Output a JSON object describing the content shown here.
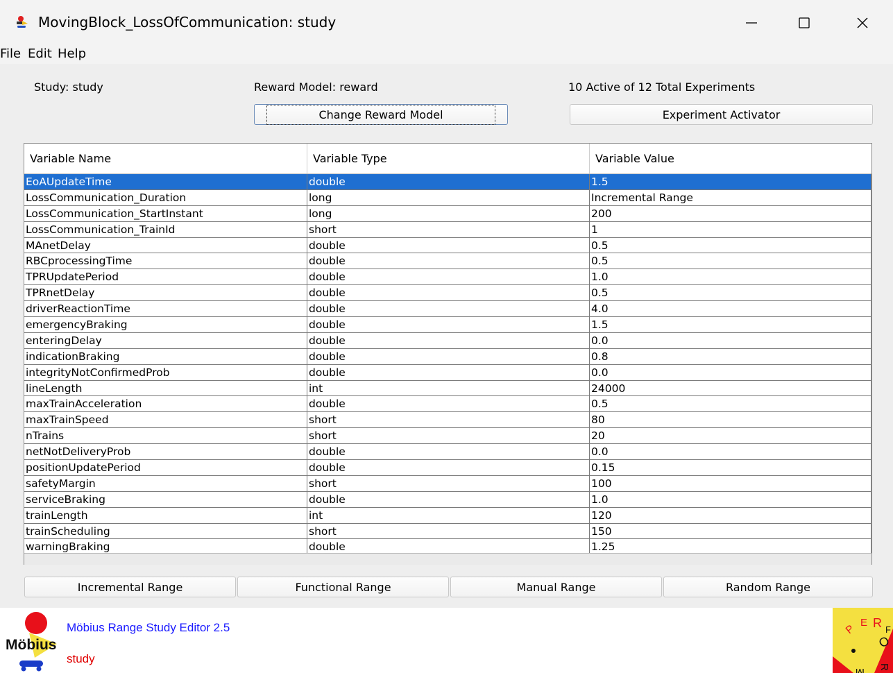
{
  "window": {
    "title": "MovingBlock_LossOfCommunication: study"
  },
  "menu": {
    "items": [
      "File",
      "Edit",
      "Help"
    ]
  },
  "header": {
    "study_label": "Study:  study",
    "reward_label": "Reward Model: reward",
    "experiments_label": "10 Active of 12 Total Experiments",
    "change_reward_button": "Change Reward Model",
    "experiment_activator_button": "Experiment Activator"
  },
  "table": {
    "columns": [
      "Variable Name",
      "Variable Type",
      "Variable Value"
    ],
    "rows": [
      [
        "EoAUpdateTime",
        "double",
        "1.5"
      ],
      [
        "LossCommunication_Duration",
        "long",
        "Incremental Range"
      ],
      [
        "LossCommunication_StartInstant",
        "long",
        "200"
      ],
      [
        "LossCommunication_TrainId",
        "short",
        "1"
      ],
      [
        "MAnetDelay",
        "double",
        "0.5"
      ],
      [
        "RBCprocessingTime",
        "double",
        "0.5"
      ],
      [
        "TPRUpdatePeriod",
        "double",
        "1.0"
      ],
      [
        "TPRnetDelay",
        "double",
        "0.5"
      ],
      [
        "driverReactionTime",
        "double",
        "4.0"
      ],
      [
        "emergencyBraking",
        "double",
        "1.5"
      ],
      [
        "enteringDelay",
        "double",
        "0.0"
      ],
      [
        "indicationBraking",
        "double",
        "0.8"
      ],
      [
        "integrityNotConfirmedProb",
        "double",
        "0.0"
      ],
      [
        "lineLength",
        "int",
        "24000"
      ],
      [
        "maxTrainAcceleration",
        "double",
        "0.5"
      ],
      [
        "maxTrainSpeed",
        "short",
        "80"
      ],
      [
        "nTrains",
        "short",
        "20"
      ],
      [
        "netNotDeliveryProb",
        "double",
        "0.0"
      ],
      [
        "positionUpdatePeriod",
        "double",
        "0.15"
      ],
      [
        "safetyMargin",
        "short",
        "100"
      ],
      [
        "serviceBraking",
        "double",
        "1.0"
      ],
      [
        "trainLength",
        "int",
        "120"
      ],
      [
        "trainScheduling",
        "short",
        "150"
      ],
      [
        "warningBraking",
        "double",
        "1.25"
      ]
    ],
    "selected_row": 0
  },
  "range_buttons": [
    "Incremental Range",
    "Functional Range",
    "Manual Range",
    "Random Range"
  ],
  "footer": {
    "logo_text": "Möbius",
    "product_label": "Möbius  Range Study Editor  2.5",
    "study_name": "study",
    "perform_logo_letters": [
      "P",
      "E",
      "R",
      "F",
      "O",
      "R",
      "M"
    ]
  },
  "colors": {
    "selection": "#1f6fd1",
    "window_bg": "#eeeeee",
    "product_label": "#1a1aff",
    "study_name": "#e00000"
  }
}
